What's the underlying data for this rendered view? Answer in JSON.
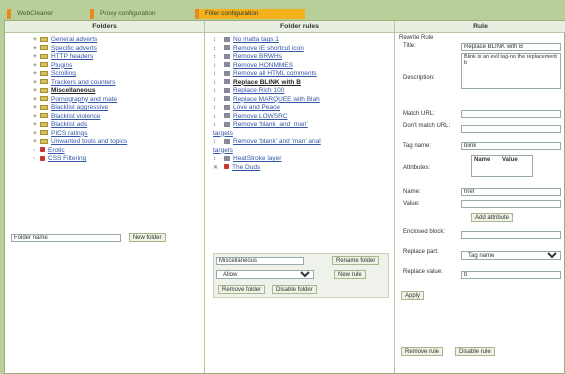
{
  "tabs": [
    "WebCleaner",
    "Proxy configuration",
    "Filter configuration"
  ],
  "folders": {
    "header": "Folders",
    "items": [
      {
        "label": "General adverts",
        "selected": false
      },
      {
        "label": "Specific adverts",
        "selected": false
      },
      {
        "label": "HTTP headers",
        "selected": false
      },
      {
        "label": "Plugins",
        "selected": false
      },
      {
        "label": "Scrolling",
        "selected": false
      },
      {
        "label": "Trackers and counters",
        "selected": false
      },
      {
        "label": "Miscellaneous",
        "selected": true
      },
      {
        "label": "Pornography and mate",
        "selected": false
      },
      {
        "label": "Blacklist aggressive",
        "selected": false
      },
      {
        "label": "Blacklist violence",
        "selected": false
      },
      {
        "label": "Blacklist ads",
        "selected": false
      },
      {
        "label": "PICS ratings",
        "selected": false
      },
      {
        "label": "Unwanted tools and topics",
        "selected": false
      },
      {
        "label": "Erotic",
        "selected": false,
        "blocked": true
      },
      {
        "label": "CSS Filtering",
        "selected": false,
        "blocked": true
      }
    ],
    "input_value": "Folder name",
    "new_folder": "New folder"
  },
  "rules": {
    "header": "Folder rules",
    "items": [
      {
        "label": "No matta tags 1",
        "selected": false
      },
      {
        "label": "Remove IE shortcut icon",
        "selected": false
      },
      {
        "label": "Remove BRWHs",
        "selected": false
      },
      {
        "label": "Remove HONMMES",
        "selected": false
      },
      {
        "label": "Remove all HTML comments",
        "selected": false
      },
      {
        "label": "Replace BLINK with B",
        "selected": true
      },
      {
        "label": "Replace Rich 100",
        "selected": false
      },
      {
        "label": "Replace MARQUEE with Blah",
        "selected": false
      },
      {
        "label": "Love and Peace",
        "selected": false
      },
      {
        "label": "Remove LOWSRC",
        "selected": false
      },
      {
        "label": "Remove 'blank_and_man'",
        "selected": false
      },
      {
        "label": "targets",
        "selected": false
      },
      {
        "label": "Remove 'blank' and 'man' anal",
        "selected": false
      },
      {
        "label": "targets",
        "selected": false
      },
      {
        "label": "HeatStroke layer",
        "selected": false
      },
      {
        "label": "The Duds",
        "selected": false,
        "blocked": true
      }
    ],
    "folder_title": "Miscellaneous",
    "rename_folder": "Rename folder",
    "rule_type": "Allow",
    "new_rule": "New rule",
    "remove_folder": "Remove folder",
    "disable_folder": "Disable folder"
  },
  "rule": {
    "header": "Rule",
    "rewrite_rule": "Rewrite Rule",
    "title_label": "Title:",
    "title_value": "Replace BLINK with B",
    "description_label": "Description:",
    "description_value": "Blink is an evil tag-no the replacement b",
    "match_url_label": "Match URL:",
    "match_url_value": "",
    "dont_match_label": "Don't match URL:",
    "dont_match_value": "",
    "tag_name_label": "Tag name:",
    "tag_name_value": "blink",
    "attributes_label": "Attributes:",
    "attr_name_header": "Name",
    "attr_value_header": "Value",
    "name_label": "Name:",
    "name_value": "href",
    "value_label": "Value:",
    "value_value": "",
    "add_attribute": "Add attribute",
    "enclosed_label": "Enclosed block:",
    "enclosed_value": "",
    "replace_part_label": "Replace part:",
    "replace_part_value": "Tag name",
    "replace_value_label": "Replace value:",
    "replace_value_value": "b",
    "apply": "Apply",
    "remove_rule": "Remove rule",
    "disable_rule": "Disable rule"
  }
}
